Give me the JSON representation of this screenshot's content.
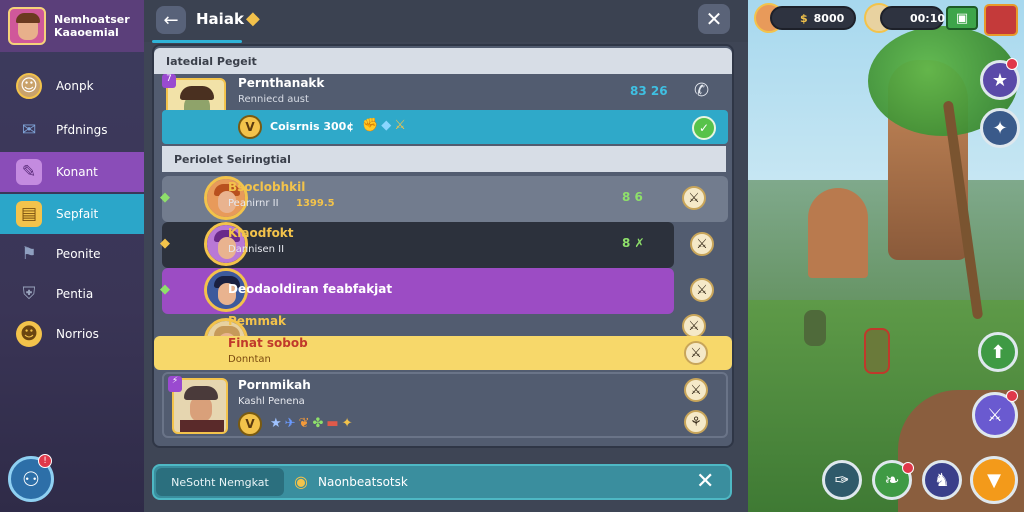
{
  "sidebar": {
    "profile_line1": "Nemhoatser",
    "profile_line2": "Kaaoemial",
    "items": [
      {
        "label": "Aonpk",
        "icon": "person-icon"
      },
      {
        "label": "Pfdnings",
        "icon": "envelope-icon"
      },
      {
        "label": "Konant",
        "icon": "quill-icon"
      },
      {
        "label": "Sepfait",
        "icon": "chest-icon"
      },
      {
        "label": "Peonite",
        "icon": "flag-icon"
      },
      {
        "label": "Pentia",
        "icon": "shield-icon"
      },
      {
        "label": "Norrios",
        "icon": "gold-badge-icon"
      }
    ],
    "invite_badge": "!"
  },
  "header": {
    "title": "Haiak",
    "back_icon": "back-arrow-icon",
    "close_icon": "close-icon"
  },
  "sections": {
    "pending_title": "Iatedial Pegeit",
    "suggested_title": "Periolet Seiringtial"
  },
  "pending": {
    "name": "Pernthanakk",
    "sub": "Renniecd aust",
    "time": "83 26",
    "action_text": "Coisrnis 300¢",
    "accept_icon": "check-icon"
  },
  "friends": [
    {
      "name": "Bsoclobhkil",
      "sub": "Peanirnr II",
      "stat": "1399.5",
      "right": "8 6"
    },
    {
      "name": "Klaodfokt",
      "sub": "Dannisen II",
      "stat": "",
      "right": "8 ✗"
    },
    {
      "name": "Deodaoldiran feabfakjat",
      "sub": "",
      "stat": "",
      "right": ""
    },
    {
      "name": "Pemmak",
      "sub": "",
      "stat": "",
      "right": ""
    },
    {
      "name": "Finat sobob",
      "sub": "Donntan",
      "stat": "",
      "right": ""
    },
    {
      "name": "Pornmikah",
      "sub": "Kashl Penena",
      "stat": "",
      "right": ""
    }
  ],
  "bottom": {
    "button_label": "NeSotht Nemgkat",
    "text": "Naonbeatsotsk"
  },
  "hud": {
    "coins": "8000",
    "timer": "00:10"
  },
  "colors": {
    "accent_cyan": "#2fb3d8",
    "accent_purple": "#8a4db8",
    "highlight_yellow": "#f7d86a",
    "gold": "#f3c34b"
  }
}
